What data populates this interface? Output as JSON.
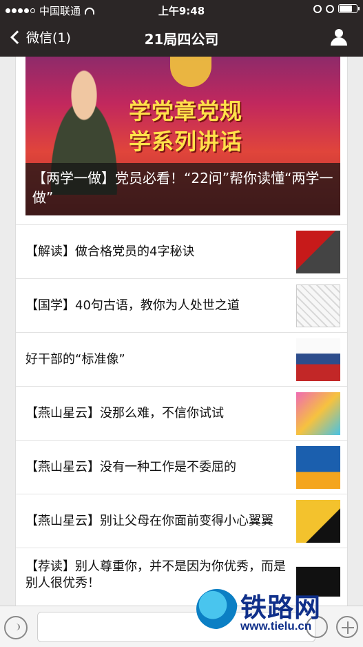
{
  "status_bar": {
    "carrier": "中国联通",
    "time": "上午9:48"
  },
  "nav": {
    "back_label": "微信(1)",
    "title": "21局四公司"
  },
  "hero": {
    "headline_1": "学党章党规",
    "headline_2": "学系列讲话",
    "caption": "【两学一做】党员必看！“22问”帮你读懂“两学一做”"
  },
  "articles": [
    {
      "title": "【解读】做合格党员的4字秘诀"
    },
    {
      "title": "【国学】40句古语，教你为人处世之道"
    },
    {
      "title": "好干部的“标准像”"
    },
    {
      "title": "【燕山星云】没那么难，不信你试试"
    },
    {
      "title": "【燕山星云】没有一种工作是不委屈的"
    },
    {
      "title": "【燕山星云】别让父母在你面前变得小心翼翼"
    },
    {
      "title": "【荐读】别人尊重你，并不是因为你优秀，而是别人很优秀！"
    }
  ],
  "watermark": {
    "brand": "铁路网",
    "url": "www.tielu.cn"
  }
}
